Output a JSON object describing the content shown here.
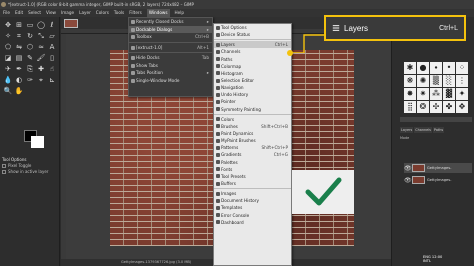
{
  "window": {
    "title": "*[extruct-1.0] (RGB color 8-bit gamma integer, GIMP built-in sRGB, 2 layers) 724x482 – GIMP"
  },
  "menubar": [
    "File",
    "Edit",
    "Select",
    "View",
    "Image",
    "Layer",
    "Colors",
    "Tools",
    "Filters",
    "Windows",
    "Help"
  ],
  "menubar_active": "Windows",
  "windows_menu": {
    "items": [
      {
        "label": "Recently Closed Docks",
        "arrow": "▸"
      },
      {
        "label": "Dockable Dialogs",
        "arrow": "▸",
        "highlight": true
      },
      {
        "label": "Toolbox",
        "accel": "Ctrl+B"
      },
      {
        "sep": true
      },
      {
        "label": "[extruct-1.0]",
        "accel": "Alt+1"
      },
      {
        "sep": true
      },
      {
        "label": "Hide Docks",
        "accel": "Tab"
      },
      {
        "label": "Show Tabs"
      },
      {
        "label": "Tabs Position",
        "arrow": "▸"
      },
      {
        "label": "Single-Window Mode"
      }
    ]
  },
  "dockable_menu": {
    "items": [
      {
        "label": "Tool Options"
      },
      {
        "label": "Device Status"
      },
      {
        "sep": true
      },
      {
        "label": "Layers",
        "accel": "Ctrl+L",
        "highlight": true
      },
      {
        "label": "Channels"
      },
      {
        "label": "Paths"
      },
      {
        "label": "Colormap"
      },
      {
        "label": "Histogram"
      },
      {
        "label": "Selection Editor"
      },
      {
        "label": "Navigation"
      },
      {
        "label": "Undo History"
      },
      {
        "label": "Pointer"
      },
      {
        "label": "Symmetry Painting"
      },
      {
        "sep": true
      },
      {
        "label": "Colors"
      },
      {
        "label": "Brushes",
        "accel": "Shift+Ctrl+B"
      },
      {
        "label": "Paint Dynamics"
      },
      {
        "label": "MyPaint Brushes"
      },
      {
        "label": "Patterns",
        "accel": "Shift+Ctrl+P"
      },
      {
        "label": "Gradients",
        "accel": "Ctrl+G"
      },
      {
        "label": "Palettes"
      },
      {
        "label": "Fonts"
      },
      {
        "label": "Tool Presets"
      },
      {
        "label": "Buffers"
      },
      {
        "sep": true
      },
      {
        "label": "Images"
      },
      {
        "label": "Document History"
      },
      {
        "label": "Templates"
      },
      {
        "label": "Error Console"
      },
      {
        "label": "Dashboard"
      }
    ]
  },
  "callout": {
    "label": "Layers",
    "shortcut": "Ctrl+L",
    "border_color": "#f4c20d"
  },
  "check_mark_color": "#1a7f4b",
  "toolbox": {
    "options_title": "Tool Options",
    "options": [
      "Pixel Toggle",
      "Show in active layer"
    ]
  },
  "dock": {
    "tabs": [
      "Layers",
      "Channels",
      "Paths"
    ],
    "mode_label": "Mode",
    "layers": [
      {
        "name": "GettyImages-"
      },
      {
        "name": "GettyImages-"
      }
    ]
  },
  "status": {
    "text": "GettyImages-1379367726.jpg (3.0 MB)"
  },
  "clock": {
    "lang": "ENG",
    "region": "INTL",
    "time": "12:00"
  }
}
